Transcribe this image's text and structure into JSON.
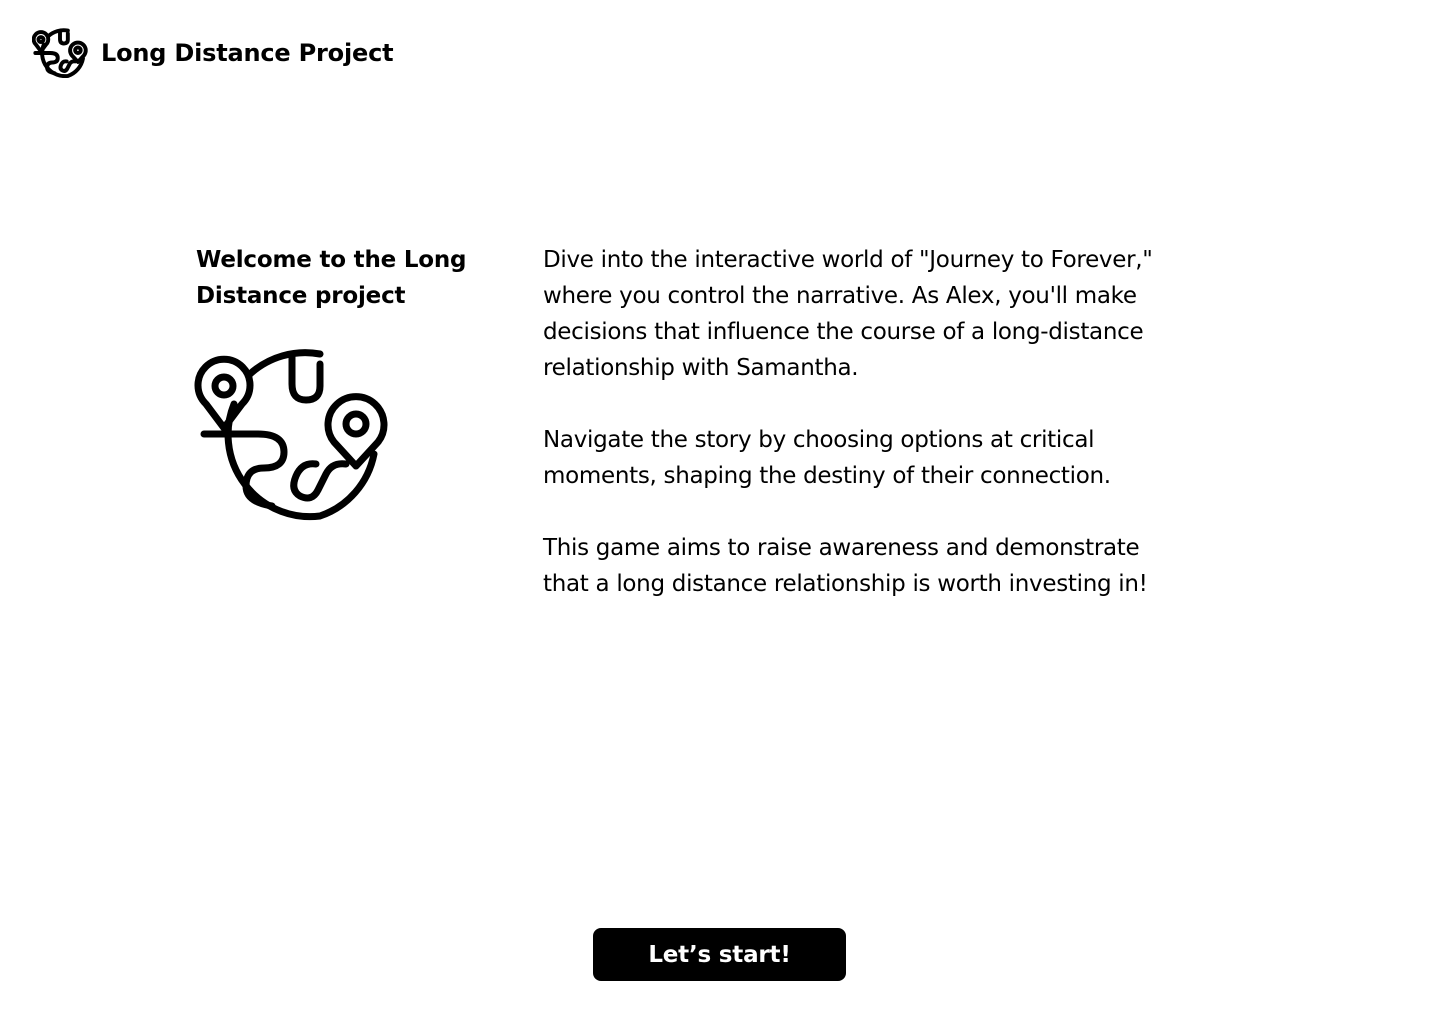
{
  "header": {
    "title": "Long Distance Project",
    "logo_icon": "globe-with-location-pins-icon"
  },
  "intro": {
    "heading": "Welcome to the Long Distance project",
    "illustration_icon": "globe-with-location-pins-icon",
    "paragraphs": [
      "Dive into the interactive world of \"Journey to Forever,\" where you control the narrative. As Alex, you'll make decisions that influence the course of a long-distance relationship with Samantha.",
      "Navigate the story by choosing options at critical moments, shaping the destiny of their connection.",
      "This game aims to raise awareness and demonstrate that a long distance relationship is worth investing in!"
    ]
  },
  "actions": {
    "start_label": "Let’s start!"
  },
  "colors": {
    "background": "#ffffff",
    "text": "#000000",
    "button_background": "#000000",
    "button_text": "#ffffff"
  }
}
